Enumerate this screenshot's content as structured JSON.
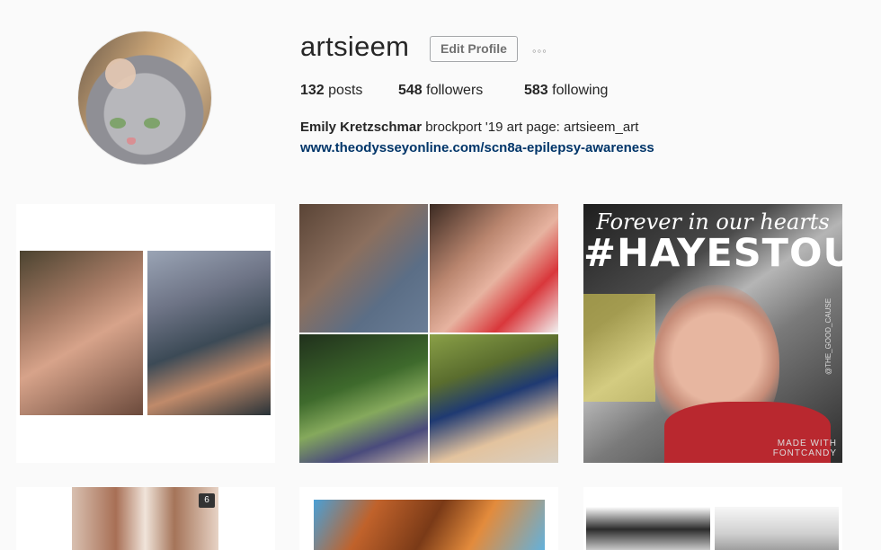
{
  "profile": {
    "username": "artsieem",
    "edit_label": "Edit Profile",
    "more_label": "◦◦◦",
    "stats": {
      "posts_count": "132",
      "posts_label": " posts",
      "followers_count": "548",
      "followers_label": " followers",
      "following_count": "583",
      "following_label": " following"
    },
    "bio_name": "Emily Kretzschmar",
    "bio_text": " brockport '19 art page: artsieem_art",
    "link": "www.theodysseyonline.com/scn8a-epilepsy-awareness"
  },
  "posts": {
    "hayes": {
      "line1": "Forever in our hearts",
      "line2": "#HAYESTOUGH",
      "side": "@THE_GOOD_CAUSE",
      "made_line1": "MADE WITH",
      "made_line2": "FONTCANDY"
    },
    "carousel_badge": "6"
  },
  "colors": {
    "link": "#003569",
    "background": "#fafafa"
  }
}
